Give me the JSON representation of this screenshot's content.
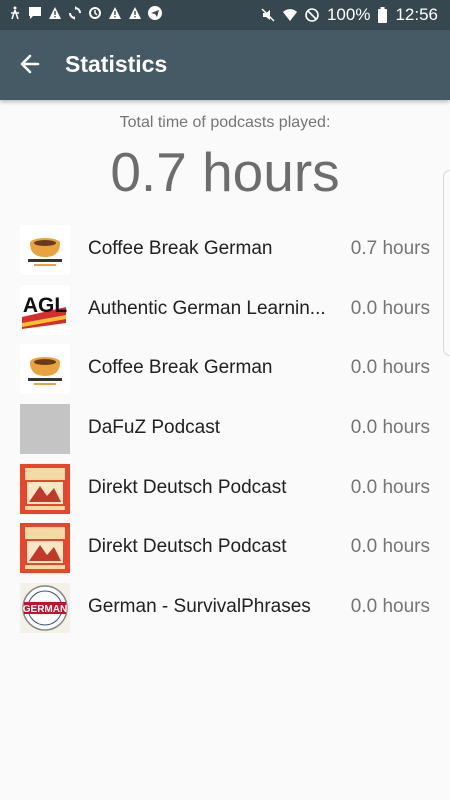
{
  "status_bar": {
    "battery": "100%",
    "time": "12:56",
    "left_icons": [
      "accessibility-icon",
      "message-icon",
      "warning-icon",
      "sync-icon",
      "update-icon",
      "warning-icon",
      "warning-icon",
      "telegram-icon"
    ],
    "right_icons": [
      "mute-icon",
      "wifi-icon",
      "no-disturb-icon",
      "battery-icon"
    ]
  },
  "app_bar": {
    "title": "Statistics",
    "back_icon": "arrow-back-icon"
  },
  "summary": {
    "label": "Total time of podcasts played:",
    "value": "0.7 hours"
  },
  "podcasts": [
    {
      "name": "Coffee Break German",
      "duration": "0.7 hours",
      "cover": "coffee-break-german-cover"
    },
    {
      "name": "Authentic German Learnin...",
      "duration": "0.0 hours",
      "cover": "agl-cover"
    },
    {
      "name": "Coffee Break German",
      "duration": "0.0 hours",
      "cover": "coffee-break-german-cover"
    },
    {
      "name": "DaFuZ Podcast",
      "duration": "0.0 hours",
      "cover": "placeholder-cover"
    },
    {
      "name": "Direkt Deutsch Podcast",
      "duration": "0.0 hours",
      "cover": "direkt-deutsch-cover"
    },
    {
      "name": "Direkt Deutsch Podcast",
      "duration": "0.0 hours",
      "cover": "direkt-deutsch-cover"
    },
    {
      "name": "German - SurvivalPhrases",
      "duration": "0.0 hours",
      "cover": "german-survival-phrases-cover"
    }
  ],
  "colors": {
    "status_bar": "#37474f",
    "app_bar": "#455a64",
    "background": "#fafafa"
  }
}
